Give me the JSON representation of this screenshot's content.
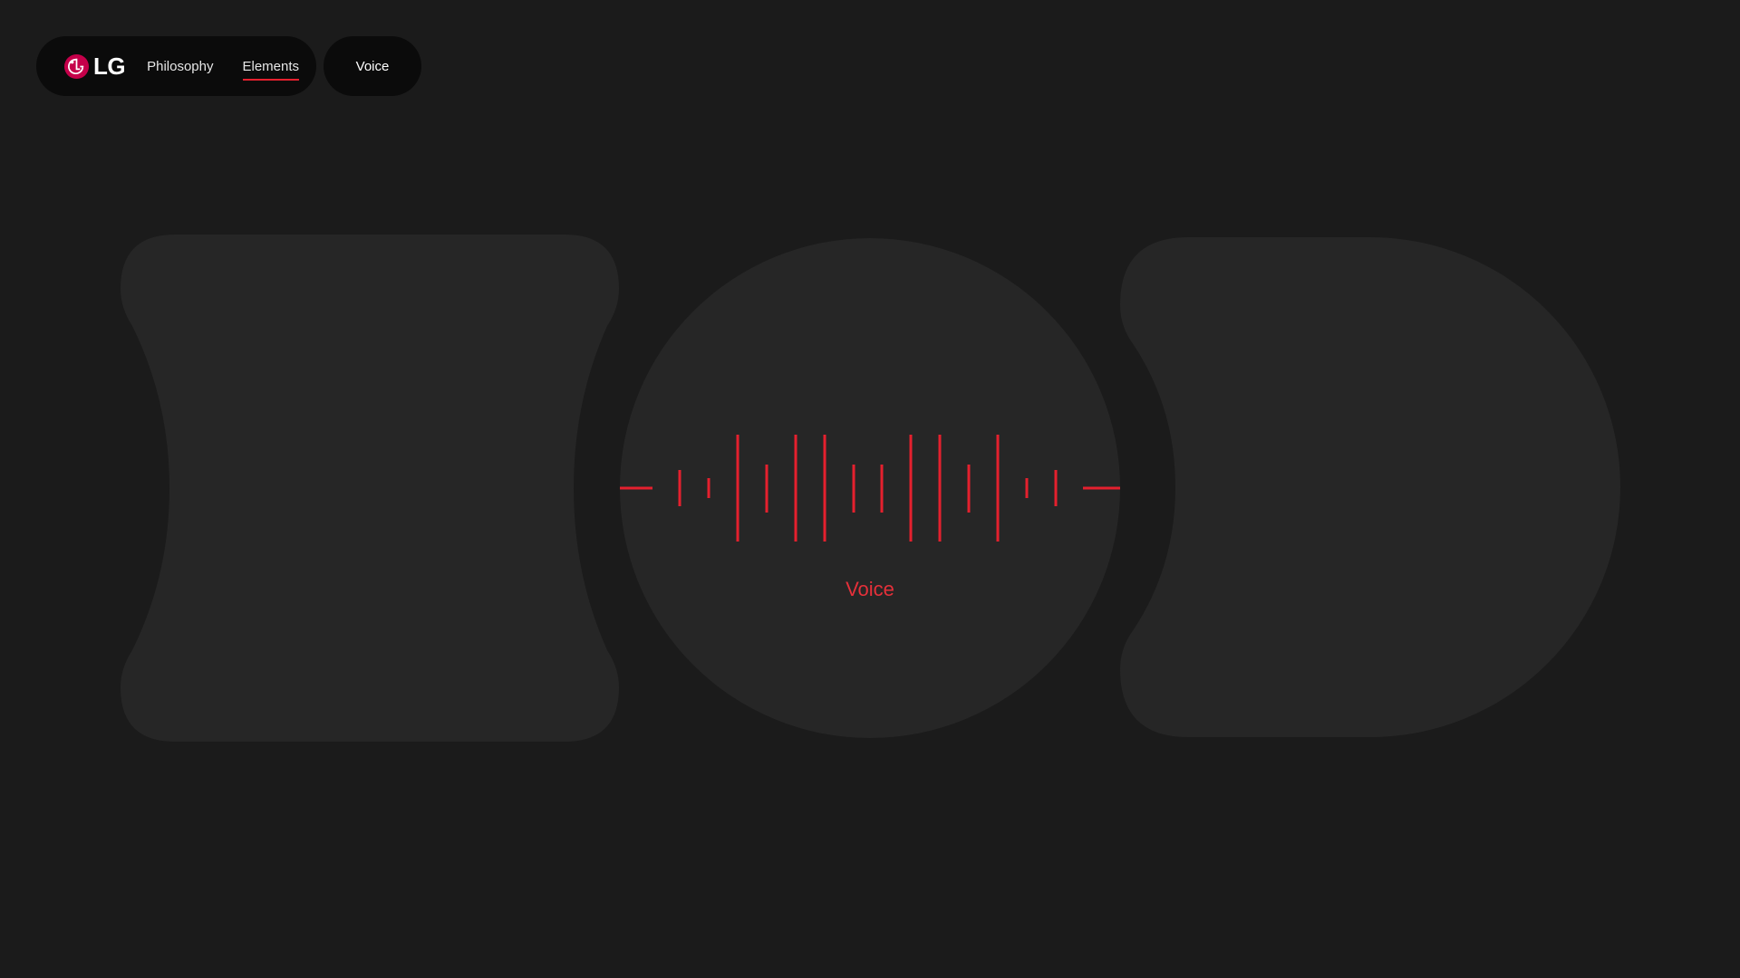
{
  "nav": {
    "logo_text": "LG",
    "logo_icon": "lg-face-logo-icon",
    "links": [
      {
        "label": "Philosophy",
        "active": false
      },
      {
        "label": "Elements",
        "active": true
      }
    ],
    "current_page_label": "Voice"
  },
  "main": {
    "shapes": [
      "concave-rounded-square",
      "circle",
      "rounded-d-shape"
    ],
    "voice_label": "Voice",
    "waveform_icon": "voice-waveform-icon"
  },
  "colors": {
    "background": "#1b1b1b",
    "nav_background": "#0b0b0b",
    "shape_fill": "#262626",
    "accent_red": "#e5202e",
    "logo_magenta": "#c5004a",
    "text_white": "#ffffff"
  }
}
